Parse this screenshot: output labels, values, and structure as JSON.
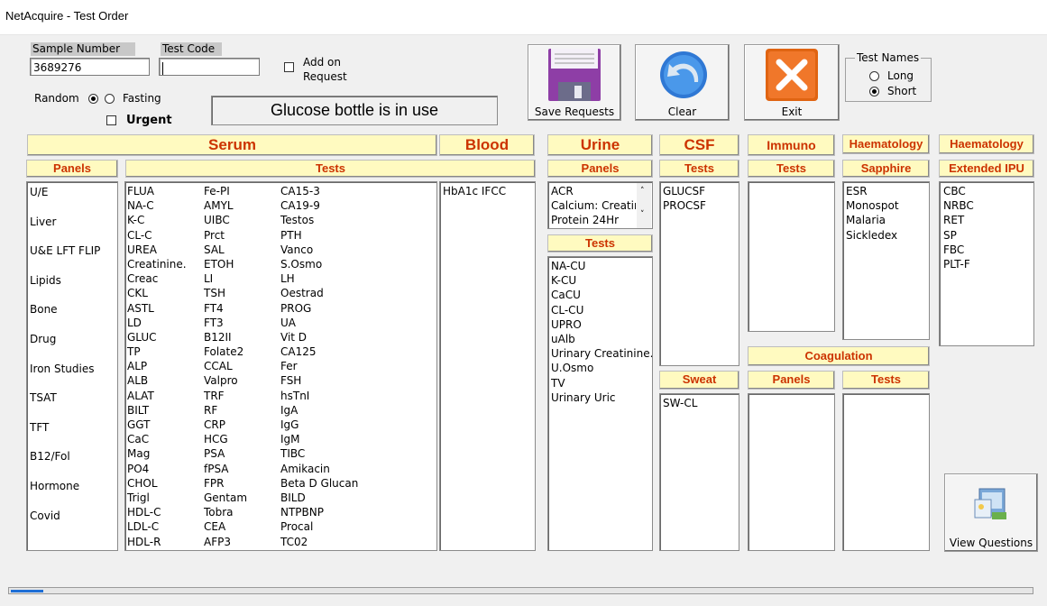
{
  "window": {
    "title": "NetAcquire - Test Order"
  },
  "form": {
    "sample_number_label": "Sample Number",
    "sample_number_value": "3689276",
    "test_code_label": "Test Code",
    "test_code_value": "",
    "add_on_label_1": "Add on",
    "add_on_label_2": "Request",
    "random_label": "Random",
    "fasting_label": "Fasting",
    "urgent_label": "Urgent",
    "message": "Glucose bottle is in use"
  },
  "buttons": {
    "save_label": "Save Requests",
    "clear_label": "Clear",
    "exit_label": "Exit",
    "view_questions_label": "View Questions"
  },
  "test_names": {
    "legend": "Test Names",
    "long_label": "Long",
    "short_label": "Short",
    "selected": "Short"
  },
  "headers": {
    "serum": "Serum",
    "blood": "Blood",
    "urine": "Urine",
    "csf": "CSF",
    "immuno": "Immuno",
    "haematology_1": "Haematology",
    "haematology_2": "Haematology",
    "panels": "Panels",
    "tests": "Tests",
    "sapphire": "Sapphire",
    "extended_ipu": "Extended IPU",
    "coagulation": "Coagulation",
    "sweat": "Sweat"
  },
  "serum_panels": [
    "U/E",
    "Liver",
    "U&E LFT FLIP",
    "Lipids",
    "Bone",
    "Drug",
    "Iron Studies",
    "TSAT",
    "TFT",
    "B12/Fol",
    "Hormone",
    "Covid"
  ],
  "serum_tests_col1": [
    "FLUA",
    "NA-C",
    "K-C",
    "CL-C",
    "UREA",
    "Creatinine.",
    "Creac",
    "CKL",
    "ASTL",
    "LD",
    "GLUC",
    "TP",
    "ALP",
    "ALB",
    "ALAT",
    "BILT",
    "GGT",
    "CaC",
    "Mag",
    "PO4",
    "CHOL",
    "Trigl",
    "HDL-C",
    "LDL-C",
    "HDL-R"
  ],
  "serum_tests_col2": [
    "Fe-PI",
    "AMYL",
    "UIBC",
    "Prct",
    "SAL",
    "ETOH",
    "LI",
    "TSH",
    "FT4",
    "FT3",
    "B12II",
    "Folate2",
    "CCAL",
    "Valpro",
    "TRF",
    "RF",
    "CRP",
    "HCG",
    "PSA",
    "fPSA",
    "FPR",
    "Gentam",
    "Tobra",
    "CEA",
    "AFP3"
  ],
  "serum_tests_col3": [
    "CA15-3",
    "CA19-9",
    "Testos",
    "PTH",
    "Vanco",
    "S.Osmo",
    "LH",
    "Oestrad",
    "PROG",
    "UA",
    "Vit D",
    "CA125",
    "Fer",
    "FSH",
    "hsTnI",
    "IgA",
    "IgG",
    "IgM",
    "TIBC",
    "Amikacin",
    "Beta D Glucan",
    "BILD",
    "NTPBNP",
    "Procal",
    "TC02"
  ],
  "blood_tests": [
    "HbA1c IFCC"
  ],
  "urine_panels": [
    "ACR",
    "Calcium: Creatinine",
    "Protein 24Hr"
  ],
  "urine_tests": [
    "NA-CU",
    "K-CU",
    "CaCU",
    "CL-CU",
    "UPRO",
    "uAlb",
    "Urinary Creatinine.",
    "U.Osmo",
    "TV",
    "Urinary Uric"
  ],
  "csf_tests": [
    "GLUCSF",
    "PROCSF"
  ],
  "sweat_tests": [
    "SW-CL"
  ],
  "sapphire_tests": [
    "ESR",
    "Monospot",
    "Malaria",
    "Sickledex"
  ],
  "extended_ipu_tests": [
    "CBC",
    "NRBC",
    "RET",
    "SP",
    "FBC",
    "PLT-F"
  ],
  "colors": {
    "header_bg": "#fffac0",
    "header_text": "#cc3300",
    "progress": "#1e6fd6"
  }
}
